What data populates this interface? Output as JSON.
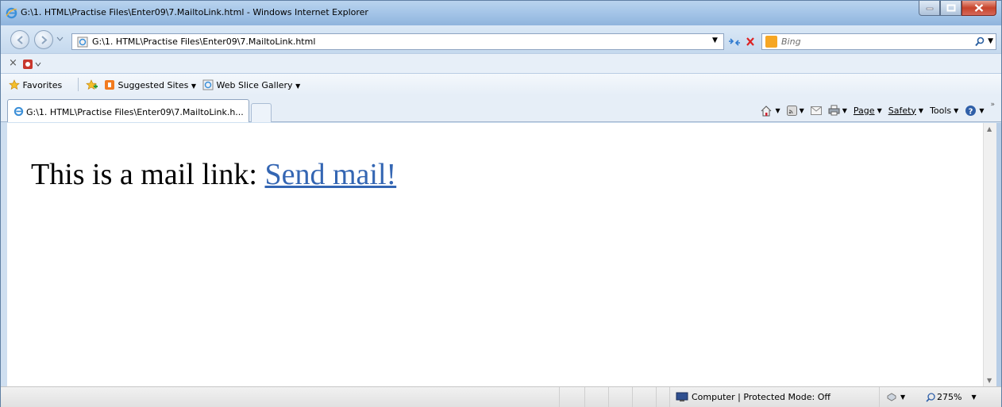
{
  "window": {
    "title": "G:\\1. HTML\\Practise Files\\Enter09\\7.MailtoLink.html - Windows Internet Explorer"
  },
  "address_bar": {
    "url": "G:\\1. HTML\\Practise Files\\Enter09\\7.MailtoLink.html"
  },
  "search": {
    "placeholder": "Bing"
  },
  "favorites_bar": {
    "favorites_label": "Favorites",
    "suggested_sites_label": "Suggested Sites",
    "web_slice_label": "Web Slice Gallery"
  },
  "tabs": [
    {
      "label": "G:\\1. HTML\\Practise Files\\Enter09\\7.MailtoLink.h..."
    }
  ],
  "command_bar": {
    "page_label": "Page",
    "safety_label": "Safety",
    "tools_label": "Tools"
  },
  "page": {
    "text": "This is a mail link: ",
    "link_text": "Send mail!"
  },
  "status_bar": {
    "zone": "Computer | Protected Mode: Off",
    "zoom": "275%"
  },
  "colors": {
    "link": "#3466b3",
    "title_bar": "#a6c6e8"
  }
}
